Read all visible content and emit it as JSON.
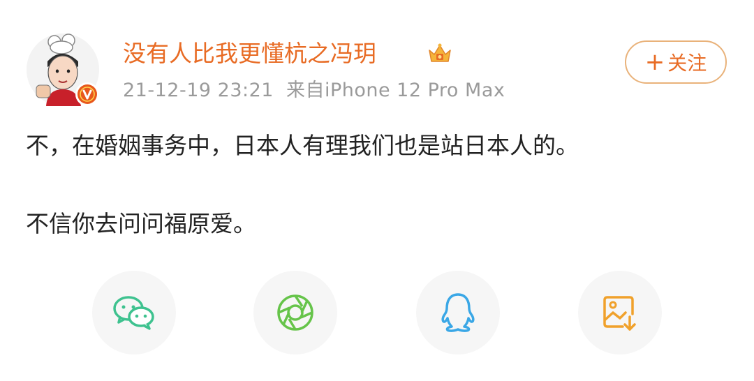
{
  "post": {
    "author": "没有人比我更懂杭之冯玥",
    "timestamp": "21-12-19 23:21",
    "source": "来自iPhone 12 Pro Max",
    "follow_label": "关注",
    "follow_plus": "+",
    "text_line1": "不，在婚姻事务中，日本人有理我们也是站日本人的。",
    "text_line2": "不信你去问问福原爱。"
  },
  "icons": {
    "author_badge": "crown-icon",
    "verified": "verified-v-icon",
    "share": [
      "wechat-icon",
      "moments-icon",
      "qq-icon",
      "save-image-icon"
    ]
  },
  "colors": {
    "accent": "#e86b24",
    "meta_text": "#9a9a9a",
    "body_text": "#222222",
    "wechat": "#3ec28f",
    "moments": "#66c44a",
    "qq": "#3aa7e6",
    "save": "#f0a12b",
    "verified": "#e8581c"
  }
}
